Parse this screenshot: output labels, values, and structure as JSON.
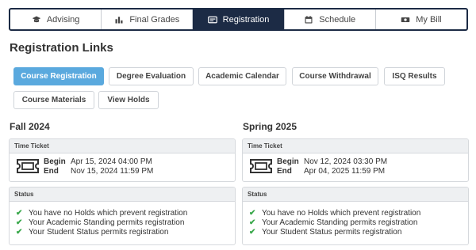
{
  "tabs": [
    {
      "label": "Advising",
      "icon": "graduation-cap-icon"
    },
    {
      "label": "Final Grades",
      "icon": "bar-chart-icon"
    },
    {
      "label": "Registration",
      "icon": "id-card-icon",
      "active": true
    },
    {
      "label": "Schedule",
      "icon": "calendar-icon"
    },
    {
      "label": "My Bill",
      "icon": "money-bill-icon"
    }
  ],
  "section_title": "Registration Links",
  "links": {
    "course_registration": "Course Registration",
    "degree_evaluation": "Degree Evaluation",
    "academic_calendar": "Academic Calendar",
    "course_withdrawal": "Course Withdrawal",
    "isq_results": "ISQ Results",
    "course_materials": "Course Materials",
    "view_holds": "View Holds"
  },
  "terms": [
    {
      "title": "Fall 2024",
      "ticket_header": "Time Ticket",
      "begin_label": "Begin",
      "begin_value": "Apr 15, 2024 04:00 PM",
      "end_label": "End",
      "end_value": "Nov 15, 2024 11:59 PM",
      "status_header": "Status",
      "status_items": [
        "You have no Holds which prevent registration",
        "Your Academic Standing permits registration",
        "Your Student Status permits registration"
      ]
    },
    {
      "title": "Spring 2025",
      "ticket_header": "Time Ticket",
      "begin_label": "Begin",
      "begin_value": "Nov 12, 2024 03:30 PM",
      "end_label": "End",
      "end_value": "Apr 04, 2025 11:59 PM",
      "status_header": "Status",
      "status_items": [
        "You have no Holds which prevent registration",
        "Your Academic Standing permits registration",
        "Your Student Status permits registration"
      ]
    }
  ],
  "colors": {
    "nav_active": "#1c2b45",
    "primary_button": "#5aa9de",
    "check": "#3aa84b"
  }
}
